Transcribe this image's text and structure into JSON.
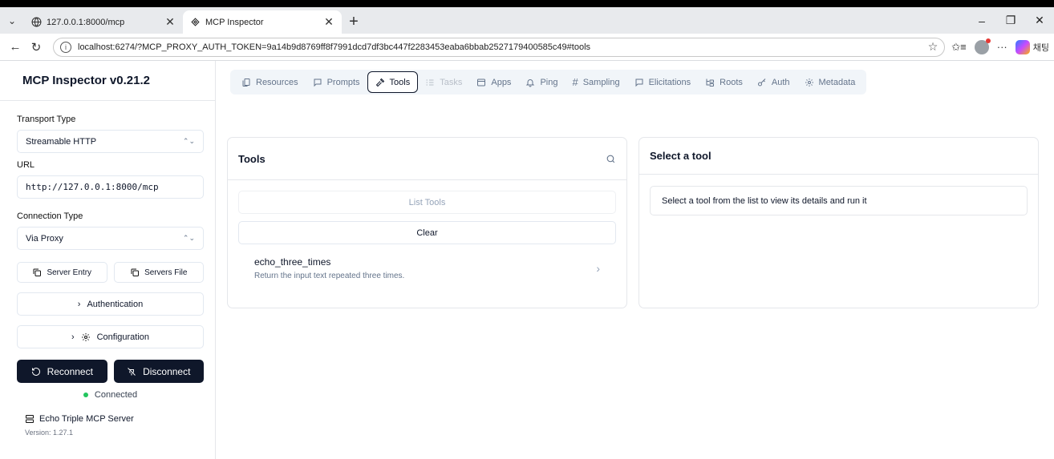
{
  "browser": {
    "tabs": [
      {
        "title": "127.0.0.1:8000/mcp",
        "icon": "globe-icon",
        "active": false
      },
      {
        "title": "MCP Inspector",
        "icon": "mcp-icon",
        "active": true
      }
    ],
    "url": "localhost:6274/?MCP_PROXY_AUTH_TOKEN=9a14b9d8769ff8f7991dcd7df3bc447f2283453eaba6bbab2527179400585c49#tools",
    "copilot_label": "채팅"
  },
  "sidebar": {
    "title": "MCP Inspector v0.21.2",
    "transport_label": "Transport Type",
    "transport_value": "Streamable HTTP",
    "url_label": "URL",
    "url_value": "http://127.0.0.1:8000/mcp",
    "connection_label": "Connection Type",
    "connection_value": "Via Proxy",
    "server_entry_label": "Server Entry",
    "servers_file_label": "Servers File",
    "authentication_label": "Authentication",
    "configuration_label": "Configuration",
    "reconnect_label": "Reconnect",
    "disconnect_label": "Disconnect",
    "status_label": "Connected",
    "status_color": "#22c55e",
    "server_name": "Echo Triple MCP Server",
    "server_version": "Version: 1.27.1"
  },
  "main": {
    "tabs": [
      {
        "label": "Resources",
        "icon": "files-icon"
      },
      {
        "label": "Prompts",
        "icon": "message-icon"
      },
      {
        "label": "Tools",
        "icon": "hammer-icon",
        "active": true
      },
      {
        "label": "Tasks",
        "icon": "list-icon",
        "disabled": true
      },
      {
        "label": "Apps",
        "icon": "app-window-icon"
      },
      {
        "label": "Ping",
        "icon": "bell-icon"
      },
      {
        "label": "Sampling",
        "icon": "hash-icon"
      },
      {
        "label": "Elicitations",
        "icon": "message-icon"
      },
      {
        "label": "Roots",
        "icon": "folder-tree-icon"
      },
      {
        "label": "Auth",
        "icon": "key-icon"
      },
      {
        "label": "Metadata",
        "icon": "gear-icon"
      }
    ],
    "tools_panel": {
      "title": "Tools",
      "list_button": "List Tools",
      "clear_button": "Clear",
      "items": [
        {
          "name": "echo_three_times",
          "description": "Return the input text repeated three times."
        }
      ]
    },
    "detail_panel": {
      "title": "Select a tool",
      "message": "Select a tool from the list to view its details and run it"
    }
  }
}
